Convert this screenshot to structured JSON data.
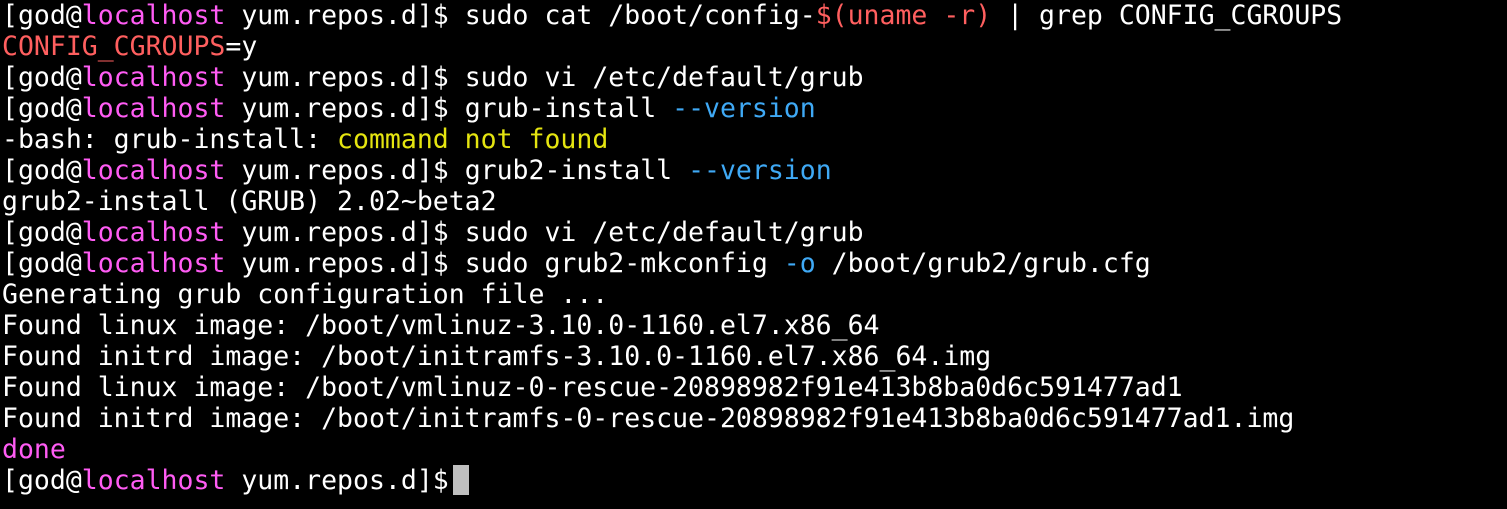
{
  "colors": {
    "background": "#000000",
    "default": "#ffffff",
    "host": "#ff5cf4",
    "red": "#ff5f5f",
    "blue": "#3fa9f5",
    "yellow": "#e5e510",
    "cursor": "#bfbfbf"
  },
  "lines": [
    {
      "kind": "command",
      "segments": [
        {
          "text": "[god@",
          "color": "default"
        },
        {
          "text": "localhost",
          "color": "host"
        },
        {
          "text": " yum.repos.d]$ sudo cat /boot/config-",
          "color": "default"
        },
        {
          "text": "$(uname -r)",
          "color": "red"
        },
        {
          "text": " | grep CONFIG_CGROUPS",
          "color": "default"
        }
      ]
    },
    {
      "kind": "output",
      "segments": [
        {
          "text": "CONFIG_CGROUPS",
          "color": "red"
        },
        {
          "text": "=y",
          "color": "default"
        }
      ]
    },
    {
      "kind": "command",
      "segments": [
        {
          "text": "[god@",
          "color": "default"
        },
        {
          "text": "localhost",
          "color": "host"
        },
        {
          "text": " yum.repos.d]$ sudo vi /etc/default/grub",
          "color": "default"
        }
      ]
    },
    {
      "kind": "command",
      "segments": [
        {
          "text": "[god@",
          "color": "default"
        },
        {
          "text": "localhost",
          "color": "host"
        },
        {
          "text": " yum.repos.d]$ grub-install ",
          "color": "default"
        },
        {
          "text": "--version",
          "color": "blue"
        }
      ]
    },
    {
      "kind": "output",
      "segments": [
        {
          "text": "-bash: grub-install: ",
          "color": "default"
        },
        {
          "text": "command not found",
          "color": "yellow"
        }
      ]
    },
    {
      "kind": "command",
      "segments": [
        {
          "text": "[god@",
          "color": "default"
        },
        {
          "text": "localhost",
          "color": "host"
        },
        {
          "text": " yum.repos.d]$ grub2-install ",
          "color": "default"
        },
        {
          "text": "--version",
          "color": "blue"
        }
      ]
    },
    {
      "kind": "output",
      "segments": [
        {
          "text": "grub2-install (GRUB) 2.02~beta2",
          "color": "default"
        }
      ]
    },
    {
      "kind": "command",
      "segments": [
        {
          "text": "[god@",
          "color": "default"
        },
        {
          "text": "localhost",
          "color": "host"
        },
        {
          "text": " yum.repos.d]$ sudo vi /etc/default/grub",
          "color": "default"
        }
      ]
    },
    {
      "kind": "command",
      "segments": [
        {
          "text": "[god@",
          "color": "default"
        },
        {
          "text": "localhost",
          "color": "host"
        },
        {
          "text": " yum.repos.d]$ sudo grub2-mkconfig ",
          "color": "default"
        },
        {
          "text": "-o",
          "color": "blue"
        },
        {
          "text": " /boot/grub2/grub.cfg",
          "color": "default"
        }
      ]
    },
    {
      "kind": "output",
      "segments": [
        {
          "text": "Generating grub configuration file ...",
          "color": "default"
        }
      ]
    },
    {
      "kind": "output",
      "segments": [
        {
          "text": "Found linux image: /boot/vmlinuz-3.10.0-1160.el7.x86_64",
          "color": "default"
        }
      ]
    },
    {
      "kind": "output",
      "segments": [
        {
          "text": "Found initrd image: /boot/initramfs-3.10.0-1160.el7.x86_64.img",
          "color": "default"
        }
      ]
    },
    {
      "kind": "output",
      "segments": [
        {
          "text": "Found linux image: /boot/vmlinuz-0-rescue-20898982f91e413b8ba0d6c591477ad1",
          "color": "default"
        }
      ]
    },
    {
      "kind": "output",
      "segments": [
        {
          "text": "Found initrd image: /boot/initramfs-0-rescue-20898982f91e413b8ba0d6c591477ad1.img",
          "color": "default"
        }
      ]
    },
    {
      "kind": "output",
      "segments": [
        {
          "text": "done",
          "color": "host"
        }
      ]
    },
    {
      "kind": "prompt",
      "segments": [
        {
          "text": "[god@",
          "color": "default"
        },
        {
          "text": "localhost",
          "color": "host"
        },
        {
          "text": " yum.repos.d]$",
          "color": "default"
        }
      ]
    }
  ]
}
